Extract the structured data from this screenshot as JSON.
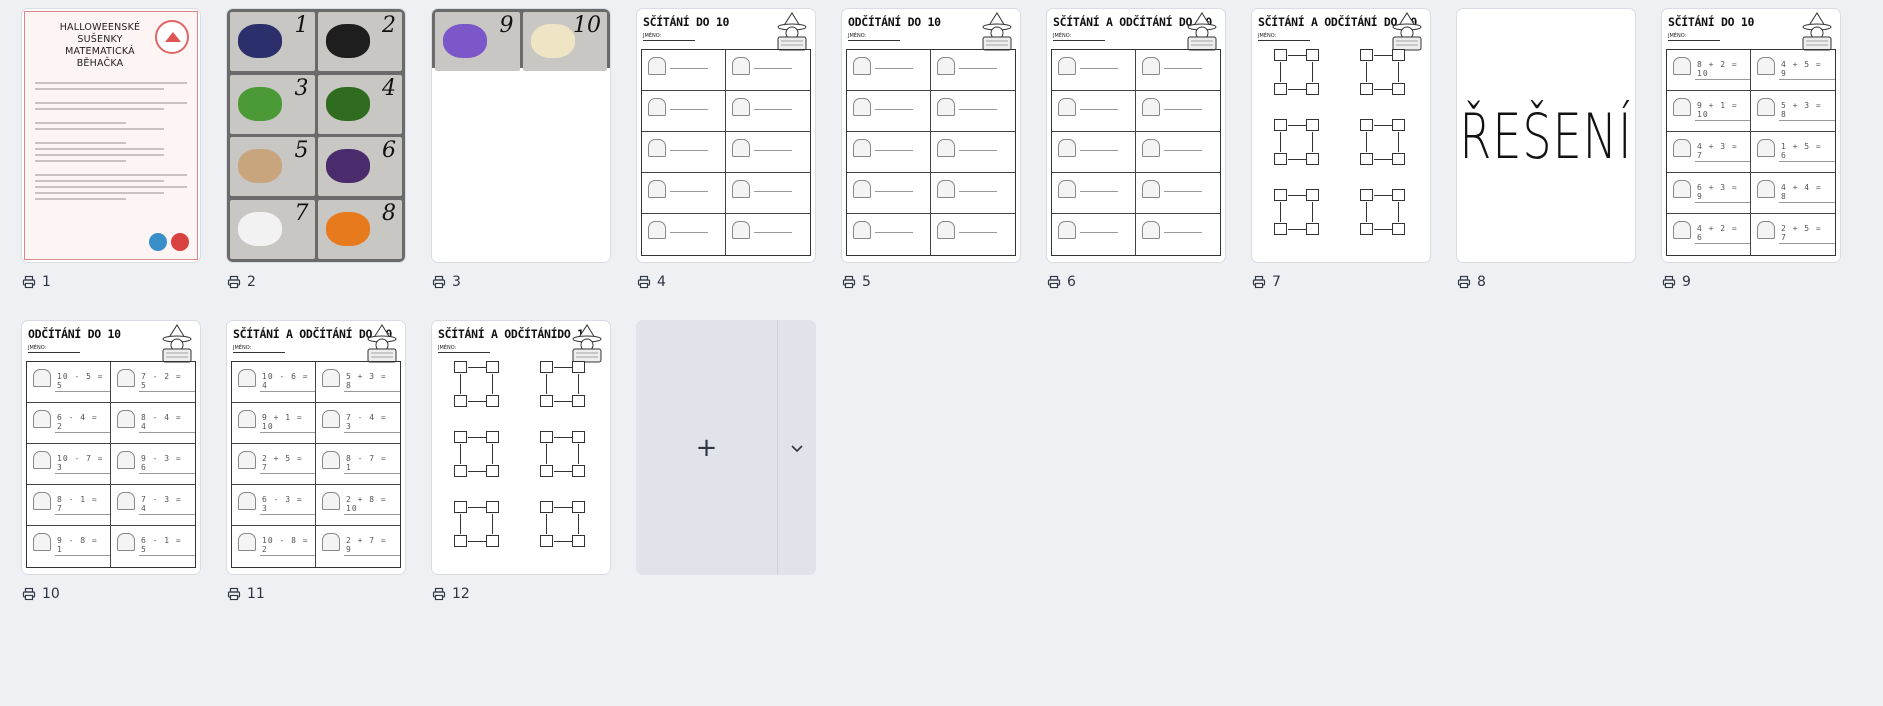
{
  "pages": [
    {
      "number": "1",
      "kind": "cover",
      "cover_title": "HALLOWEENSKÉ SUŠENKY MATEMATICKÁ BĚHAČKA"
    },
    {
      "number": "2",
      "kind": "cookies",
      "tiles": [
        "1",
        "2",
        "3",
        "4",
        "5",
        "6",
        "7",
        "8"
      ]
    },
    {
      "number": "3",
      "kind": "cookies-short",
      "tiles": [
        "9",
        "10"
      ]
    },
    {
      "number": "4",
      "kind": "worksheet",
      "title": "SČÍTÁNÍ DO 10",
      "name_label": "JMÉNO:"
    },
    {
      "number": "5",
      "kind": "worksheet",
      "title": "ODČÍTÁNÍ DO 10",
      "name_label": "JMÉNO:"
    },
    {
      "number": "6",
      "kind": "worksheet",
      "title": "SČÍTÁNÍ A ODČÍTÁNÍ DO 10",
      "name_label": "JMÉNO:"
    },
    {
      "number": "7",
      "kind": "schema",
      "title": "SČÍTÁNÍ A ODČÍTÁNÍ DO 10",
      "name_label": "JMÉNO:"
    },
    {
      "number": "8",
      "kind": "solution",
      "text": "ŘEŠENÍ"
    },
    {
      "number": "9",
      "kind": "worksheet-solved",
      "title": "SČÍTÁNÍ DO 10",
      "name_label": "JMÉNO:",
      "equations": [
        "8 + 2 = 10",
        "4 + 5 = 9",
        "9 + 1 = 10",
        "5 + 3 = 8",
        "4 + 3 = 7",
        "1 + 5 = 6",
        "6 + 3 = 9",
        "4 + 4 = 8",
        "4 + 2 = 6",
        "2 + 5 = 7"
      ]
    },
    {
      "number": "10",
      "kind": "worksheet-solved",
      "title": "ODČÍTÁNÍ DO 10",
      "name_label": "JMÉNO:",
      "equations": [
        "10 - 5 = 5",
        "7 - 2 = 5",
        "6 - 4 = 2",
        "8 - 4 = 4",
        "10 - 7 = 3",
        "9 - 3 = 6",
        "8 - 1 = 7",
        "7 - 3 = 4",
        "9 - 8 = 1",
        "6 - 1 = 5"
      ]
    },
    {
      "number": "11",
      "kind": "worksheet-solved",
      "title": "SČÍTÁNÍ A ODČÍTÁNÍ DO 10",
      "name_label": "JMÉNO:",
      "equations": [
        "10 - 6 = 4",
        "5 + 3 = 8",
        "9 + 1 = 10",
        "7 - 4 = 3",
        "2 + 5 = 7",
        "8 - 7 = 1",
        "6 - 3 = 3",
        "2 + 8 = 10",
        "10 - 8 = 2",
        "2 + 7 = 9"
      ]
    },
    {
      "number": "12",
      "kind": "schema-solved",
      "title": "SČÍTÁNÍ A ODČÍTÁNÍDO 10",
      "name_label": "JMÉNO:"
    }
  ],
  "add_button": {
    "label": "+"
  },
  "colors": {
    "background": "#eef0f4",
    "card_border": "#d9dce3",
    "add_tile": "#e0e3e9"
  },
  "icons": {
    "page_label": "printer-icon",
    "add": "plus-icon",
    "dropdown": "chevron-down-icon"
  }
}
